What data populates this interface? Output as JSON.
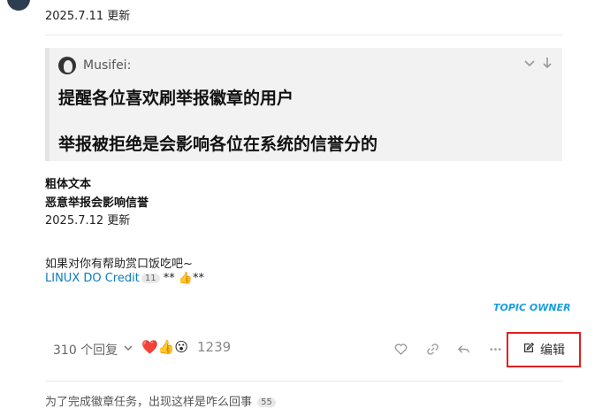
{
  "post": {
    "update_date_1": "2025.7.11 更新",
    "quote": {
      "author": "Musifei:",
      "line1": "提醒各位喜欢刷举报徽章的用户",
      "line2": "举报被拒绝是会影响各位在系统的信誉分的"
    },
    "bold_line_1": "粗体文本",
    "bold_line_2": "恶意举报会影响信誉",
    "update_date_2": "2025.7.12 更新",
    "tip_text": "如果对你有帮助赏口饭吃吧~",
    "credit_link": "LINUX DO Credit",
    "credit_badge": "11",
    "credit_suffix": "** 👍**",
    "owner_tag": "TOPIC OWNER"
  },
  "footer": {
    "replies_label": "310 个回复",
    "reaction_count": "1239",
    "edit_label": "编辑"
  },
  "next_topic": {
    "title": "为了完成徽章任务，出现这样是咋么回事",
    "count": "55"
  },
  "colors": {
    "link": "#0a7ec2",
    "owner_tag": "#1a9ee0",
    "highlight_box": "#e02020"
  }
}
